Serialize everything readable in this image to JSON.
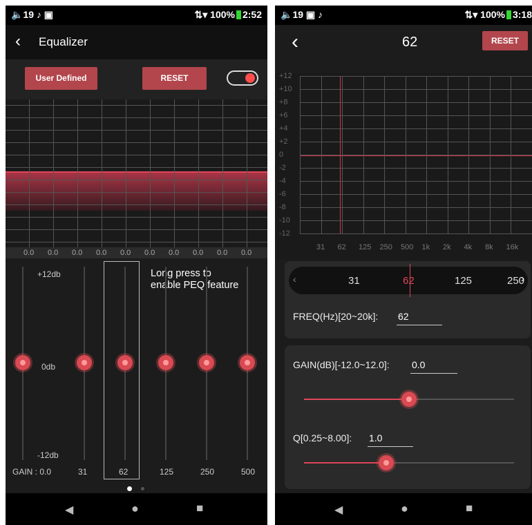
{
  "left": {
    "status": {
      "volume": "19",
      "battery": "100%",
      "time": "2:52"
    },
    "header": {
      "title": "Equalizer"
    },
    "controls": {
      "preset": "User Defined",
      "reset": "RESET",
      "toggle_on": true
    },
    "graph": {
      "band_values": [
        "0.0",
        "0.0",
        "0.0",
        "0.0",
        "0.0",
        "0.0",
        "0.0",
        "0.0",
        "0.0",
        "0.0"
      ]
    },
    "sliders": {
      "top_label": "+12db",
      "mid_label": "0db",
      "bottom_label": "-12db",
      "gain_label": "GAIN : 0.0",
      "bands": [
        "31",
        "62",
        "125",
        "250",
        "500"
      ],
      "hint": "Long press to\nenable PEQ feature"
    }
  },
  "right": {
    "status": {
      "volume": "19",
      "battery": "100%",
      "time": "3:18"
    },
    "header": {
      "title": "62",
      "reset": "RESET"
    },
    "graph": {
      "y_labels": [
        "+12",
        "+10",
        "+8",
        "+6",
        "+4",
        "+2",
        "0",
        "-2",
        "-4",
        "-6",
        "-8",
        "-10",
        "-12"
      ],
      "x_labels": [
        "31",
        "62",
        "125",
        "250",
        "500",
        "1k",
        "2k",
        "4k",
        "8k",
        "16k"
      ]
    },
    "picker": {
      "items": [
        "31",
        "62",
        "125",
        "250"
      ]
    },
    "freq": {
      "label": "FREQ(Hz)[20~20k]:",
      "value": "62"
    },
    "gain": {
      "label": "GAIN(dB)[-12.0~12.0]:",
      "value": "0.0",
      "slider_fraction": 0.5
    },
    "q": {
      "label": "Q[0.25~8.00]:",
      "value": "1.0",
      "slider_fraction": 0.39
    }
  },
  "colors": {
    "accent": "#b2464c",
    "knob": "#d94a52",
    "curve": "#d8334a"
  }
}
